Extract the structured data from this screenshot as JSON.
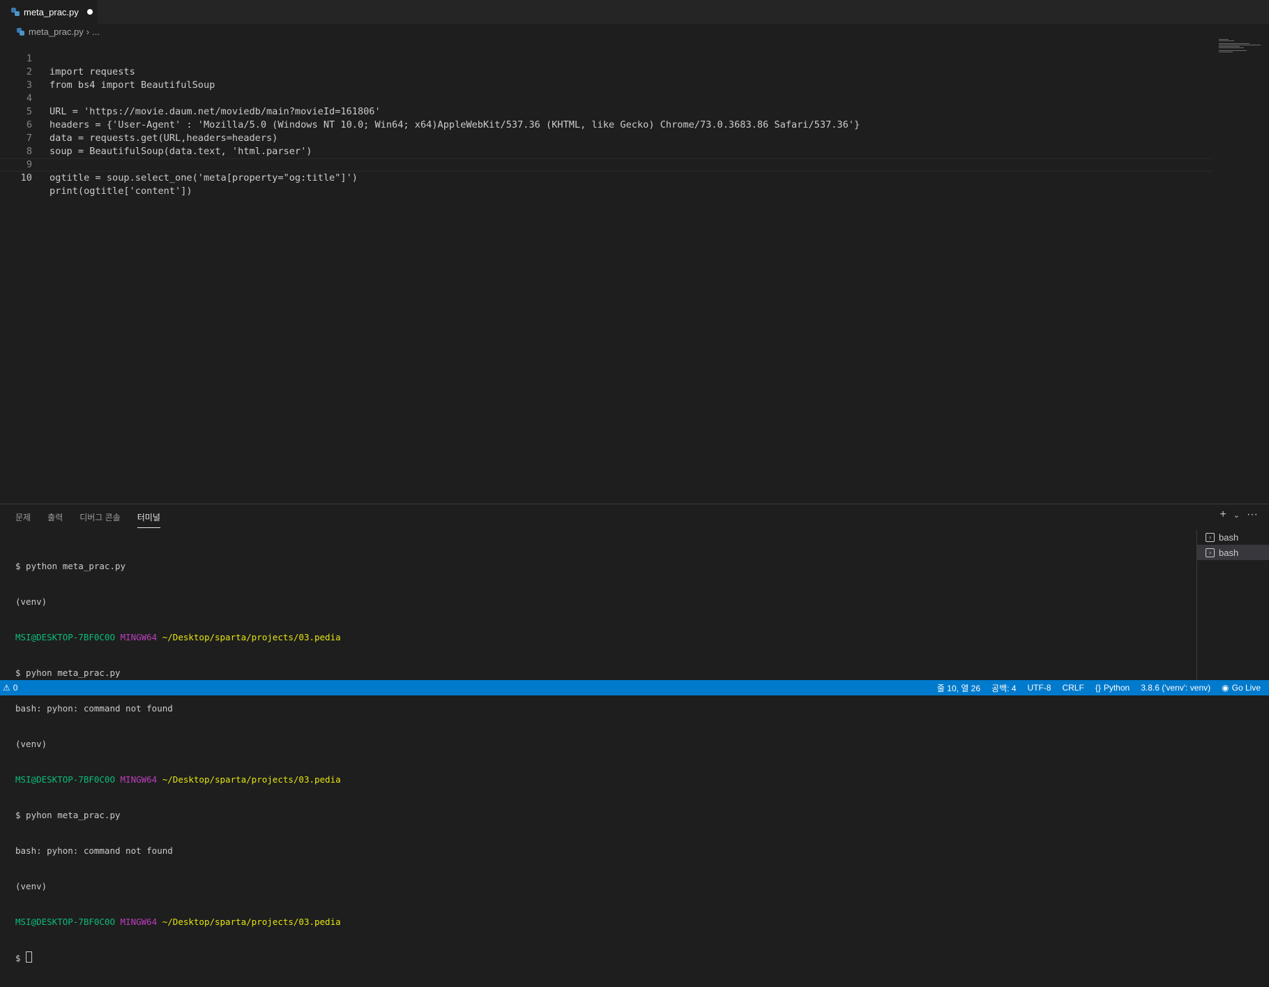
{
  "tab": {
    "filename": "meta_prac.py"
  },
  "breadcrumb": {
    "file": "meta_prac.py",
    "ellipsis": "..."
  },
  "editor": {
    "line_numbers": [
      "1",
      "2",
      "3",
      "4",
      "5",
      "6",
      "7",
      "8",
      "9",
      "10"
    ],
    "lines": [
      "import requests",
      "from bs4 import BeautifulSoup",
      "",
      "URL = 'https://movie.daum.net/moviedb/main?movieId=161806'",
      "headers = {'User-Agent' : 'Mozilla/5.0 (Windows NT 10.0; Win64; x64)AppleWebKit/537.36 (KHTML, like Gecko) Chrome/73.0.3683.86 Safari/537.36'}",
      "data = requests.get(URL,headers=headers)",
      "soup = BeautifulSoup(data.text, 'html.parser')",
      "",
      "ogtitle = soup.select_one('meta[property=\"og:title\"]')",
      "print(ogtitle['content'])"
    ]
  },
  "panel": {
    "tabs": [
      "문제",
      "출력",
      "디버그 콘솔",
      "터미널"
    ],
    "active_tab": "터미널",
    "terminal_lines": [
      "$ python meta_prac.py",
      "(venv)",
      "MSI@DESKTOP-7BF0C0O MINGW64 ~/Desktop/sparta/projects/03.pedia",
      "$ pyhon meta_prac.py",
      "bash: pyhon: command not found",
      "(venv)",
      "MSI@DESKTOP-7BF0C0O MINGW64 ~/Desktop/sparta/projects/03.pedia",
      "$ pyhon meta_prac.py",
      "bash: pyhon: command not found",
      "(venv)",
      "MSI@DESKTOP-7BF0C0O MINGW64 ~/Desktop/sparta/projects/03.pedia",
      "$ "
    ],
    "prompt": {
      "user": "MSI@DESKTOP-7BF0C0O",
      "shell": "MINGW64",
      "path": "~/Desktop/sparta/projects/03.pedia"
    },
    "terminals": [
      "bash",
      "bash"
    ],
    "selected_terminal": 1
  },
  "status": {
    "warnings": "0",
    "position": "줄 10, 열 26",
    "spaces": "공백: 4",
    "encoding": "UTF-8",
    "eol": "CRLF",
    "language": "Python",
    "interpreter": "3.8.6 ('venv': venv)",
    "golive": "Go Live"
  },
  "colors": {
    "status_bar": "#007acc",
    "editor_bg": "#1e1e1e",
    "keyword": "#c586c0",
    "string": "#ce9178",
    "variable": "#9cdcfe",
    "class": "#4ec9b0",
    "function": "#dcdcaa",
    "terminal_green": "#0dbc79",
    "terminal_magenta": "#bc3fbc",
    "terminal_yellow": "#e5e510"
  }
}
